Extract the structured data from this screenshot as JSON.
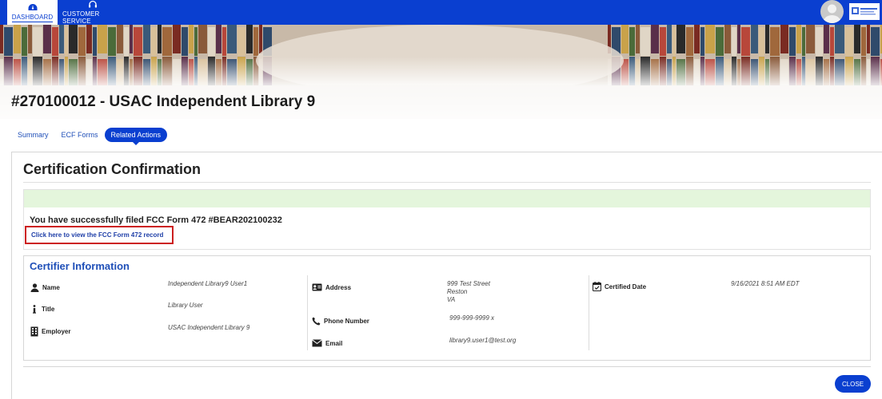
{
  "nav": {
    "dashboard_label": "DASHBOARD",
    "customer_service_label": "CUSTOMER SERVICE"
  },
  "page": {
    "title": "#270100012 - USAC Independent Library 9"
  },
  "tabs": [
    {
      "label": "Summary"
    },
    {
      "label": "ECF Forms"
    },
    {
      "label": "Related Actions"
    }
  ],
  "confirmation": {
    "heading": "Certification Confirmation",
    "success_message": "You have successfully filed FCC Form 472 #BEAR202100232",
    "link_text": "Click here to view the FCC Form 472 record"
  },
  "certifier": {
    "heading": "Certifier Information",
    "name_label": "Name",
    "name_value": "Independent Library9 User1",
    "title_label": "Title",
    "title_value": "Library User",
    "employer_label": "Employer",
    "employer_value": "USAC Independent Library 9",
    "address_label": "Address",
    "address_line1": "999 Test Street",
    "address_line2": "Reston",
    "address_line3": "VA",
    "phone_label": "Phone Number",
    "phone_value": "999-999-9999 x",
    "email_label": "Email",
    "email_value": "library9.user1@test.org",
    "certified_date_label": "Certified Date",
    "certified_date_value": "9/16/2021 8:51 AM EDT"
  },
  "actions": {
    "close_label": "CLOSE"
  },
  "colors": {
    "nav_blue": "#0a3fd0",
    "link_blue": "#1f4fb8",
    "success_green": "#e4f6dc",
    "highlight_red": "#cc1f1f"
  }
}
